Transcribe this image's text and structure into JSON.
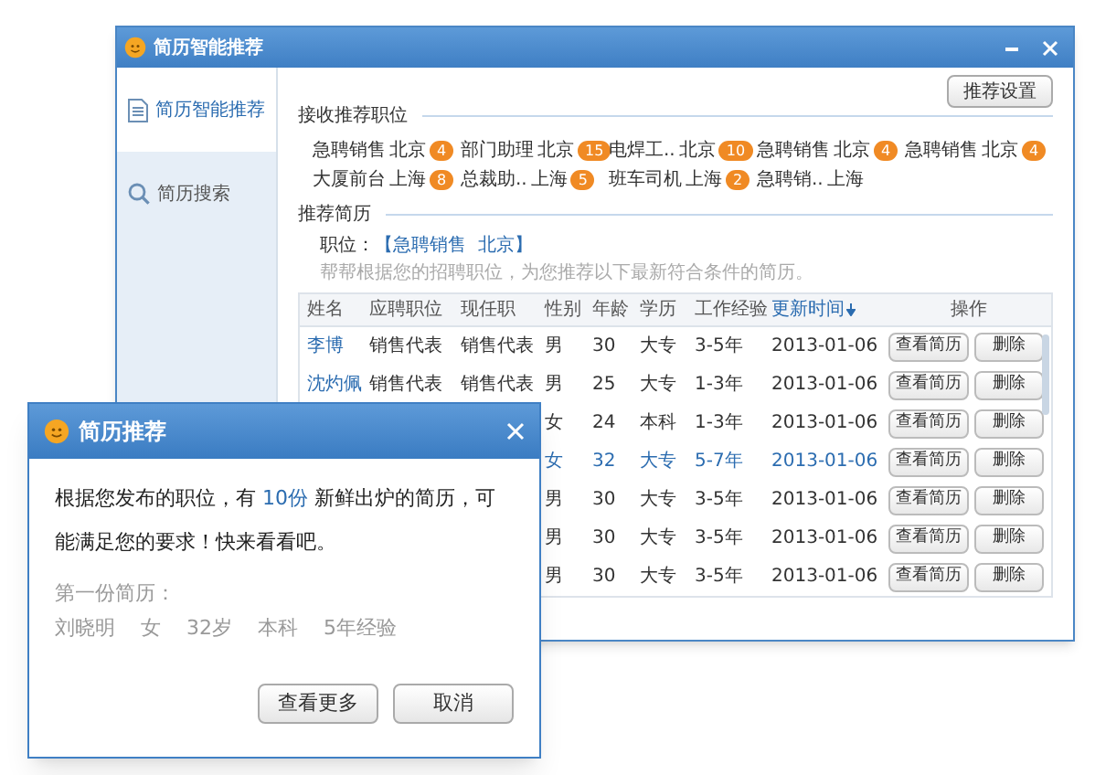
{
  "window": {
    "title": "简历智能推荐"
  },
  "sidebar": {
    "items": [
      {
        "label": "简历智能推荐",
        "kind": "doc",
        "selected": true
      },
      {
        "label": "简历搜索",
        "kind": "search",
        "selected": false
      }
    ]
  },
  "settings_button": "推荐设置",
  "positions_section": {
    "title": "接收推荐职位",
    "tags": [
      {
        "name": "急聘销售",
        "city": "北京",
        "count": "4"
      },
      {
        "name": "部门助理",
        "city": "北京",
        "count": "15"
      },
      {
        "name": "电焊工..",
        "city": "北京",
        "count": "10"
      },
      {
        "name": "急聘销售",
        "city": "北京",
        "count": "4"
      },
      {
        "name": "急聘销售",
        "city": "北京",
        "count": "4"
      },
      {
        "name": "大厦前台",
        "city": "上海",
        "count": "8"
      },
      {
        "name": "总裁助..",
        "city": "上海",
        "count": "5"
      },
      {
        "name": "班车司机",
        "city": "上海",
        "count": "2"
      },
      {
        "name": "急聘销..",
        "city": "上海"
      }
    ]
  },
  "resumes_section": {
    "title": "推荐简历",
    "position_label": "职位：",
    "position_link": "【急聘销售  北京】",
    "hint": "帮帮根据您的招聘职位，为您推荐以下最新符合条件的简历。"
  },
  "table": {
    "columns": [
      {
        "label": "姓名",
        "sorted": false
      },
      {
        "label": "应聘职位",
        "sorted": false
      },
      {
        "label": "现任职",
        "sorted": false
      },
      {
        "label": "性别",
        "sorted": false
      },
      {
        "label": "年龄",
        "sorted": false
      },
      {
        "label": "学历",
        "sorted": false
      },
      {
        "label": "工作经验",
        "sorted": false
      },
      {
        "label": "更新时间",
        "sorted": true
      },
      {
        "label": "操作",
        "sorted": false
      }
    ],
    "rows": [
      {
        "selected": false,
        "name": "李博",
        "applied": "销售代表",
        "current": "销售代表",
        "gender": "男",
        "age": "30",
        "edu": "大专",
        "exp": "3-5年",
        "time": "2013-01-06",
        "view": "查看简历",
        "delete": "删除"
      },
      {
        "selected": false,
        "name": "沈灼佩",
        "applied": "销售代表",
        "current": "销售代表",
        "gender": "男",
        "age": "25",
        "edu": "大专",
        "exp": "1-3年",
        "time": "2013-01-06",
        "view": "查看简历",
        "delete": "删除"
      },
      {
        "selected": false,
        "gender": "女",
        "age": "24",
        "edu": "本科",
        "exp": "1-3年",
        "time": "2013-01-06",
        "view": "查看简历",
        "delete": "删除"
      },
      {
        "selected": true,
        "gender": "女",
        "age": "32",
        "edu": "大专",
        "exp": "5-7年",
        "time": "2013-01-06",
        "view": "查看简历",
        "delete": "删除"
      },
      {
        "selected": false,
        "gender": "男",
        "age": "30",
        "edu": "大专",
        "exp": "3-5年",
        "time": "2013-01-06",
        "view": "查看简历",
        "delete": "删除"
      },
      {
        "selected": false,
        "gender": "男",
        "age": "30",
        "edu": "大专",
        "exp": "3-5年",
        "time": "2013-01-06",
        "view": "查看简历",
        "delete": "删除"
      },
      {
        "selected": false,
        "gender": "男",
        "age": "30",
        "edu": "大专",
        "exp": "3-5年",
        "time": "2013-01-06",
        "view": "查看简历",
        "delete": "删除"
      }
    ]
  },
  "popup": {
    "title": "简历推荐",
    "message_parts": [
      "根据您发布的职位，有",
      "10份",
      "新鲜出炉的简历，可能满足您的要求！快来看看吧。"
    ],
    "first_label": "第一份简历：",
    "first_details": [
      "刘晓明",
      "女",
      "32岁",
      "本科",
      "5年经验"
    ],
    "buttons": [
      "查看更多",
      "取消"
    ]
  }
}
